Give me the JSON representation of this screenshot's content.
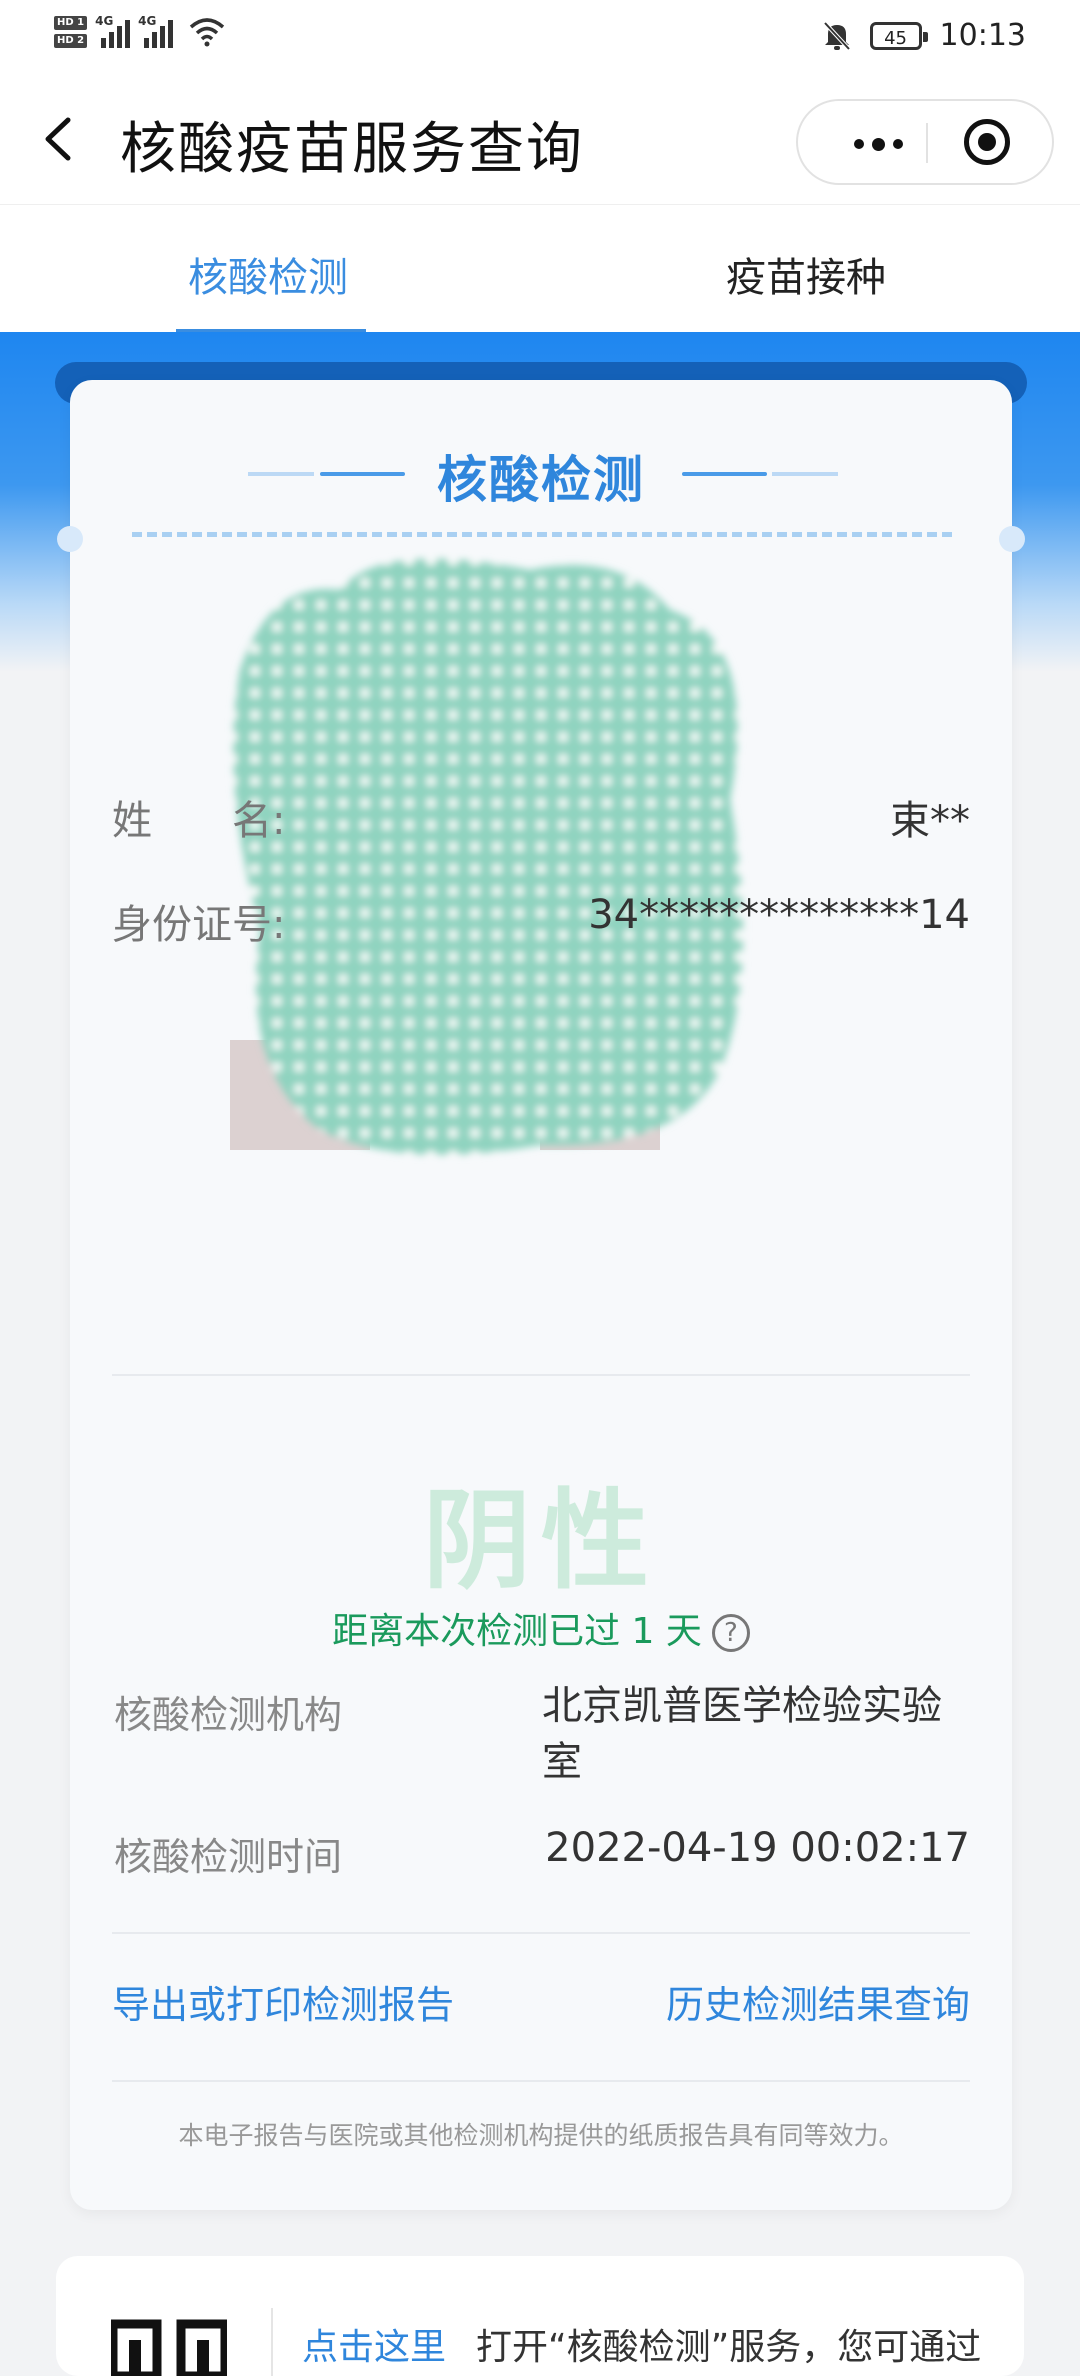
{
  "status_bar": {
    "net1": "4G",
    "net2": "4G",
    "battery": "45",
    "time": "10:13"
  },
  "nav": {
    "title": "核酸疫苗服务查询"
  },
  "tabs": [
    {
      "label": "核酸检测",
      "active": true
    },
    {
      "label": "疫苗接种",
      "active": false
    }
  ],
  "card": {
    "title": "核酸检测",
    "name_label": "姓　　名:",
    "name_value": "束**",
    "id_label": "身份证号:",
    "id_value": "34**************14",
    "result": "阴性",
    "elapsed_text": "距离本次检测已过 1 天",
    "help_icon": "?",
    "institution_label": "核酸检测机构",
    "institution_value": "北京凯普医学检验实验室",
    "time_label": "核酸检测时间",
    "time_value": "2022-04-19 00:02:17",
    "export_link": "导出或打印检测报告",
    "history_link": "历史检测结果查询",
    "footnote": "本电子报告与医院或其他检测机构提供的纸质报告具有同等效力。"
  },
  "bottom": {
    "link": "点击这里",
    "text": "打开“核酸检测”服务，您可通过"
  },
  "colors": {
    "accent": "#2f86dc",
    "negative_result": "#cdebdc",
    "elapsed": "#1a9a5c",
    "header_blue": "#1e86f0"
  }
}
